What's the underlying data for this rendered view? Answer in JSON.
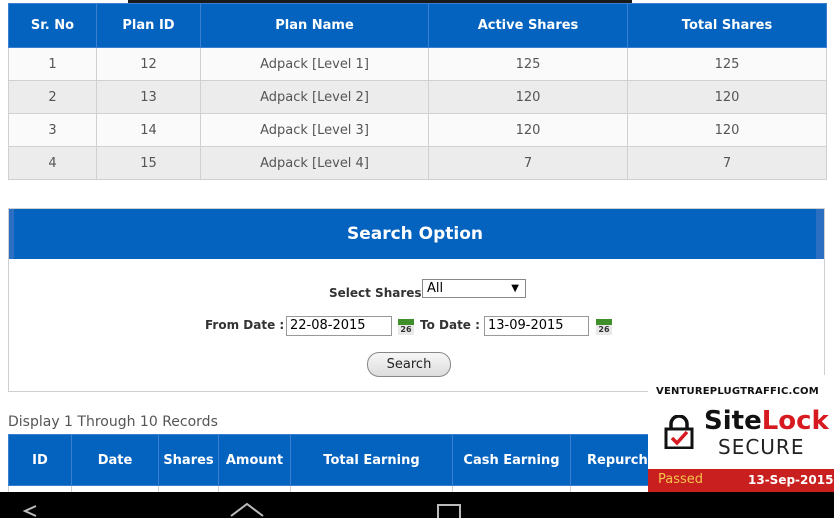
{
  "shares_table": {
    "columns": [
      "Sr. No",
      "Plan ID",
      "Plan Name",
      "Active Shares",
      "Total Shares"
    ],
    "rows": [
      [
        "1",
        "12",
        "Adpack [Level 1]",
        "125",
        "125"
      ],
      [
        "2",
        "13",
        "Adpack [Level 2]",
        "120",
        "120"
      ],
      [
        "3",
        "14",
        "Adpack [Level 3]",
        "120",
        "120"
      ],
      [
        "4",
        "15",
        "Adpack [Level 4]",
        "7",
        "7"
      ]
    ]
  },
  "search": {
    "title": "Search Option",
    "select_label": "Select Shares",
    "select_value": "All",
    "from_label": "From Date :",
    "from_value": "22-08-2015",
    "to_label": "To Date :",
    "to_value": "13-09-2015",
    "calendar_day": "26",
    "button_label": "Search"
  },
  "display_text": "Display 1 Through 10 Records",
  "earnings_table": {
    "columns": [
      "ID",
      "Date",
      "Shares",
      "Amount",
      "Total Earning",
      "Cash Earning",
      "Repurch"
    ]
  },
  "sitelock": {
    "domain": "VENTUREPLUGTRAFFIC.COM",
    "brand_a": "Site",
    "brand_b": "Lock",
    "secure": "SECURE",
    "status": "Passed",
    "date": "13-Sep-2015"
  },
  "colors": {
    "header_blue": "#0563c0",
    "sitelock_red": "#c91f1f"
  },
  "icons": [
    "calendar-icon",
    "lock-icon",
    "nav-back-icon",
    "nav-home-icon",
    "nav-recent-icon"
  ]
}
